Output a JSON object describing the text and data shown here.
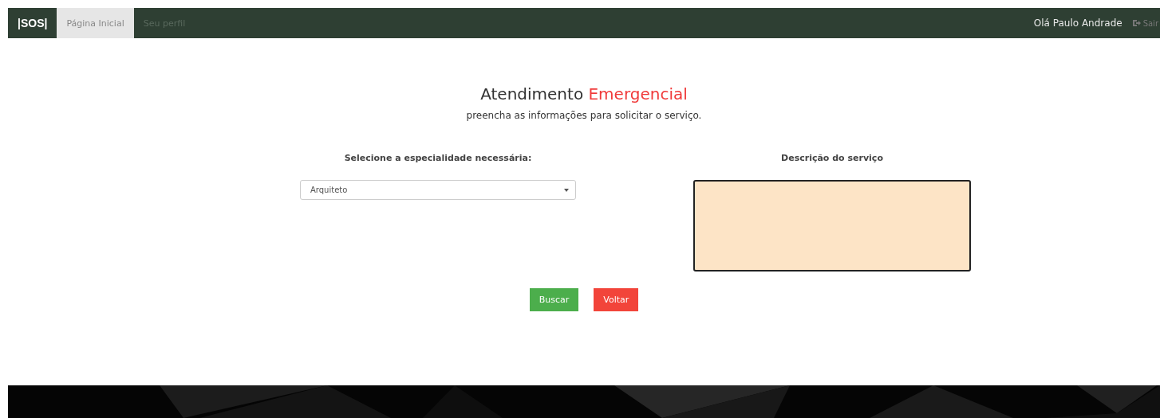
{
  "navbar": {
    "brand": "|SOS|",
    "tabs": [
      {
        "label": "Página Inicial",
        "selected": true
      },
      {
        "label": "Seu perfil",
        "selected": false
      }
    ],
    "greeting": "Olá Paulo Andrade",
    "logout": "Sair"
  },
  "heading": {
    "title": "Atendimento ",
    "highlight": "Emergencial",
    "subtitle": "preencha as informações para solicitar o serviço."
  },
  "specialty": {
    "label": "Selecione a especialidade necessária:",
    "value": "Arquiteto"
  },
  "description": {
    "label": "Descrição do serviço"
  },
  "buttons": [
    {
      "label": "Buscar",
      "kind": "primary"
    },
    {
      "label": "Voltar",
      "kind": "danger"
    }
  ]
}
